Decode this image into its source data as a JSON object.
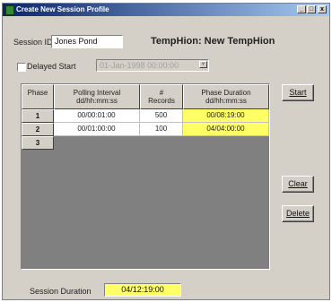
{
  "window": {
    "title": "Create New Session Profile",
    "controls": {
      "minimize": "_",
      "maximize": "□",
      "close": "x"
    }
  },
  "session": {
    "id_label": "Session ID",
    "id_value": "Jones Pond",
    "device_title": "TempHion: New TempHion"
  },
  "delayed_start": {
    "label": "Delayed Start",
    "checked": false,
    "value": "01-Jan-1998 00:00:00"
  },
  "table": {
    "headers": [
      [
        "Phase"
      ],
      [
        "Polling Interval",
        "dd/hh:mm:ss"
      ],
      [
        "#",
        "Records"
      ],
      [
        "Phase Duration",
        "dd/hh:mm:ss"
      ]
    ],
    "rows": [
      {
        "phase": "1",
        "interval": "00/00:01:00",
        "records": "500",
        "duration": "00/08:19:00"
      },
      {
        "phase": "2",
        "interval": "00/01:00:00",
        "records": "100",
        "duration": "04/04:00:00"
      },
      {
        "phase": "3",
        "interval": "",
        "records": "",
        "duration": ""
      }
    ]
  },
  "buttons": {
    "start": "Start",
    "clear": "Clear",
    "delete": "Delete"
  },
  "footer": {
    "duration_label": "Session Duration",
    "duration_value": "04/12:19:00"
  },
  "colors": {
    "highlight": "#ffff66",
    "titlebar": "#0a246a"
  }
}
